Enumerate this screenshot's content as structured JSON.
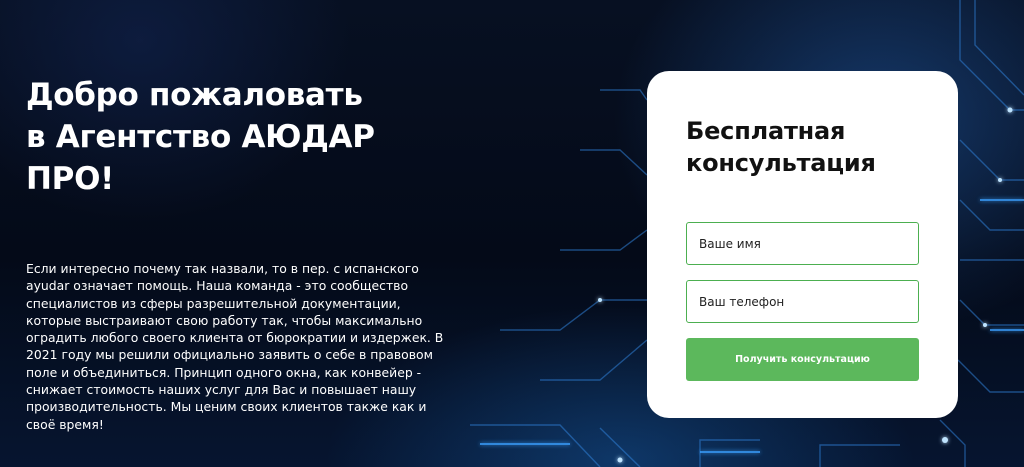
{
  "hero": {
    "title_lines": [
      "Добро пожаловать",
      "в Агентство АЮДАР",
      "ПРО!"
    ],
    "description_lines": [
      "Если интересно почему так назвали, то в пер. с испанского",
      "ayudar означает помощь. Наша команда - это сообщество",
      "специалистов из сферы разрешительной документации,",
      "которые выстраивают свою работу так, чтобы максимально",
      "оградить любого своего клиента от бюрократии и издержек. В",
      "2021 году мы решили официально заявить о себе в правовом",
      "поле и объединиться. Принцип одного окна, как конвейер -",
      "снижает стоимость наших услуг для Вас и повышает нашу",
      "производительность. Мы ценим своих клиентов также как и",
      "своё время!"
    ]
  },
  "form": {
    "title_lines": [
      "Бесплатная",
      "консультация"
    ],
    "name_placeholder": "Ваше имя",
    "name_value": "",
    "phone_placeholder": "Ваш телефон",
    "phone_value": "",
    "submit_label": "Получить консультацию"
  },
  "colors": {
    "accent_green": "#5cb85c",
    "field_border": "#4caf50",
    "background_dark": "#040a18",
    "circuit_glow": "#3aa0ff"
  }
}
